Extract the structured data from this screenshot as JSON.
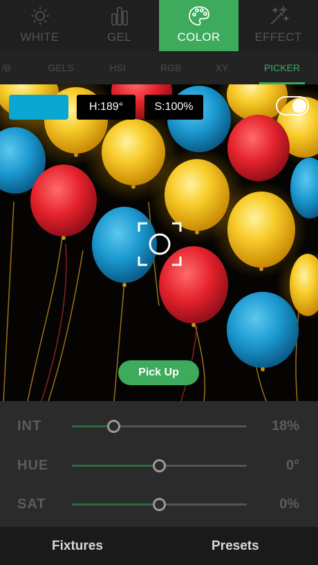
{
  "mode_tabs": [
    {
      "label": "WHITE",
      "icon": "sun-icon"
    },
    {
      "label": "GEL",
      "icon": "gel-bars-icon"
    },
    {
      "label": "COLOR",
      "icon": "palette-icon",
      "active": true
    },
    {
      "label": "EFFECT",
      "icon": "magic-wand-icon"
    }
  ],
  "sub_tabs": [
    {
      "label": "/B"
    },
    {
      "label": "GELS"
    },
    {
      "label": "HSI"
    },
    {
      "label": "RGB"
    },
    {
      "label": "XY"
    },
    {
      "label": "PICKER",
      "active": true
    }
  ],
  "picker": {
    "swatch_color": "#0aa7d1",
    "hue_chip": "H:189°",
    "sat_chip": "S:100%",
    "toggle_on": true,
    "pickup_label": "Pick Up"
  },
  "sliders": [
    {
      "label": "INT",
      "value": "18%",
      "level": 0.24
    },
    {
      "label": "HUE",
      "value": "0°",
      "level": 0.5
    },
    {
      "label": "SAT",
      "value": "0%",
      "level": 0.5
    }
  ],
  "bottom_nav": {
    "fixtures": "Fixtures",
    "presets": "Presets"
  },
  "colors": {
    "accent": "#3daa5c",
    "balloon_blue": "#1e9ed1",
    "balloon_yellow": "#f7c520",
    "balloon_red": "#e8242c"
  }
}
